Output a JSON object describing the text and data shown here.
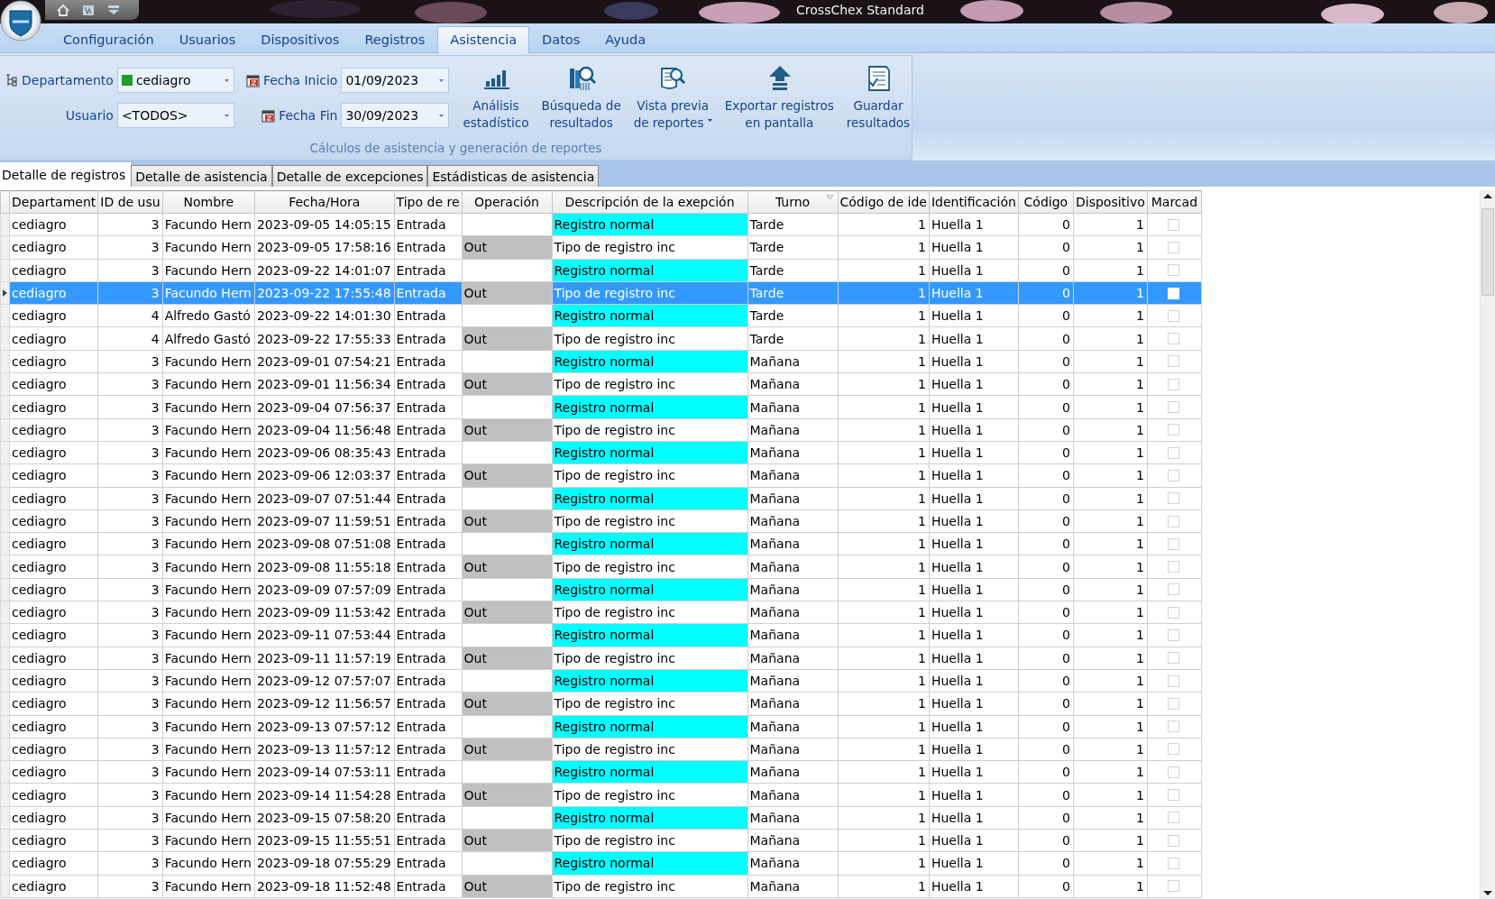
{
  "window": {
    "title": "CrossChex Standard"
  },
  "menu": [
    {
      "label": "Configuración",
      "selected": false
    },
    {
      "label": "Usuarios",
      "selected": false
    },
    {
      "label": "Dispositivos",
      "selected": false
    },
    {
      "label": "Registros",
      "selected": false
    },
    {
      "label": "Asistencia",
      "selected": true
    },
    {
      "label": "Datos",
      "selected": false
    },
    {
      "label": "Ayuda",
      "selected": false
    }
  ],
  "ribbon": {
    "department": {
      "label": "Departamento",
      "value": "cediagro"
    },
    "user": {
      "label": "Usuario",
      "value": "<TODOS>"
    },
    "start_date": {
      "label": "Fecha Inicio",
      "value": "01/09/2023"
    },
    "end_date": {
      "label": "Fecha Fin",
      "value": "30/09/2023"
    },
    "buttons": [
      {
        "lines": [
          "Análisis",
          "estadístico"
        ],
        "kind": "chart",
        "dropdown": false
      },
      {
        "lines": [
          "Búsqueda de",
          "resultados"
        ],
        "kind": "search",
        "dropdown": false
      },
      {
        "lines": [
          "Vista previa",
          "de reportes"
        ],
        "kind": "preview",
        "dropdown": true
      },
      {
        "lines": [
          "Exportar registros",
          "en pantalla"
        ],
        "kind": "export",
        "dropdown": false
      },
      {
        "lines": [
          "Guardar",
          "resultados"
        ],
        "kind": "save",
        "dropdown": false
      }
    ],
    "group_label": "Cálculos de asistencia y generación de reportes"
  },
  "sheet_tabs": [
    {
      "label": "Detalle de registros",
      "selected": true
    },
    {
      "label": "Detalle de asistencia",
      "selected": false
    },
    {
      "label": "Detalle de excepciones",
      "selected": false
    },
    {
      "label": "Estádisticas de asistencia",
      "selected": false
    }
  ],
  "table": {
    "columns": [
      "Departament",
      "ID de usu",
      "Nombre",
      "Fecha/Hora",
      "Tipo de re",
      "Operación",
      "Descripción de la exepción",
      "Turno",
      "Código de ide",
      "Identificación",
      "Código",
      "Dispositivo",
      "Marcad"
    ],
    "rows": [
      {
        "department": "cediagro",
        "user_id": "3",
        "name": "Facundo Hern",
        "datetime": "2023-09-05 14:05:15",
        "type": "Entrada",
        "kind": "in",
        "description": "Registro normal",
        "shift": "Tarde",
        "id_code": "1",
        "identification": "Huella 1",
        "code": "0",
        "device": "1",
        "marked": false,
        "selected": false
      },
      {
        "department": "cediagro",
        "user_id": "3",
        "name": "Facundo Hern",
        "datetime": "2023-09-05 17:58:16",
        "type": "Entrada",
        "kind": "out",
        "operation": "Out",
        "description": "Tipo de registro inc",
        "shift": "Tarde",
        "id_code": "1",
        "identification": "Huella 1",
        "code": "0",
        "device": "1",
        "marked": false,
        "selected": false
      },
      {
        "department": "cediagro",
        "user_id": "3",
        "name": "Facundo Hern",
        "datetime": "2023-09-22 14:01:07",
        "type": "Entrada",
        "kind": "in",
        "description": "Registro normal",
        "shift": "Tarde",
        "id_code": "1",
        "identification": "Huella 1",
        "code": "0",
        "device": "1",
        "marked": false,
        "selected": false
      },
      {
        "department": "cediagro",
        "user_id": "3",
        "name": "Facundo Hern",
        "datetime": "2023-09-22 17:55:48",
        "type": "Entrada",
        "kind": "out",
        "operation": "Out",
        "description": "Tipo de registro inc",
        "shift": "Tarde",
        "id_code": "1",
        "identification": "Huella 1",
        "code": "0",
        "device": "1",
        "marked": false,
        "selected": true
      },
      {
        "department": "cediagro",
        "user_id": "4",
        "name": "Alfredo Gastó",
        "datetime": "2023-09-22 14:01:30",
        "type": "Entrada",
        "kind": "in",
        "description": "Registro normal",
        "shift": "Tarde",
        "id_code": "1",
        "identification": "Huella 1",
        "code": "0",
        "device": "1",
        "marked": false,
        "selected": false
      },
      {
        "department": "cediagro",
        "user_id": "4",
        "name": "Alfredo Gastó",
        "datetime": "2023-09-22 17:55:33",
        "type": "Entrada",
        "kind": "out",
        "operation": "Out",
        "description": "Tipo de registro inc",
        "shift": "Tarde",
        "id_code": "1",
        "identification": "Huella 1",
        "code": "0",
        "device": "1",
        "marked": false,
        "selected": false
      },
      {
        "department": "cediagro",
        "user_id": "3",
        "name": "Facundo Hern",
        "datetime": "2023-09-01 07:54:21",
        "type": "Entrada",
        "kind": "in",
        "description": "Registro normal",
        "shift": "Mañana",
        "id_code": "1",
        "identification": "Huella 1",
        "code": "0",
        "device": "1",
        "marked": false,
        "selected": false
      },
      {
        "department": "cediagro",
        "user_id": "3",
        "name": "Facundo Hern",
        "datetime": "2023-09-01 11:56:34",
        "type": "Entrada",
        "kind": "out",
        "operation": "Out",
        "description": "Tipo de registro inc",
        "shift": "Mañana",
        "id_code": "1",
        "identification": "Huella 1",
        "code": "0",
        "device": "1",
        "marked": false,
        "selected": false
      },
      {
        "department": "cediagro",
        "user_id": "3",
        "name": "Facundo Hern",
        "datetime": "2023-09-04 07:56:37",
        "type": "Entrada",
        "kind": "in",
        "description": "Registro normal",
        "shift": "Mañana",
        "id_code": "1",
        "identification": "Huella 1",
        "code": "0",
        "device": "1",
        "marked": false,
        "selected": false
      },
      {
        "department": "cediagro",
        "user_id": "3",
        "name": "Facundo Hern",
        "datetime": "2023-09-04 11:56:48",
        "type": "Entrada",
        "kind": "out",
        "operation": "Out",
        "description": "Tipo de registro inc",
        "shift": "Mañana",
        "id_code": "1",
        "identification": "Huella 1",
        "code": "0",
        "device": "1",
        "marked": false,
        "selected": false
      },
      {
        "department": "cediagro",
        "user_id": "3",
        "name": "Facundo Hern",
        "datetime": "2023-09-06 08:35:43",
        "type": "Entrada",
        "kind": "in",
        "description": "Registro normal",
        "shift": "Mañana",
        "id_code": "1",
        "identification": "Huella 1",
        "code": "0",
        "device": "1",
        "marked": false,
        "selected": false
      },
      {
        "department": "cediagro",
        "user_id": "3",
        "name": "Facundo Hern",
        "datetime": "2023-09-06 12:03:37",
        "type": "Entrada",
        "kind": "out",
        "operation": "Out",
        "description": "Tipo de registro inc",
        "shift": "Mañana",
        "id_code": "1",
        "identification": "Huella 1",
        "code": "0",
        "device": "1",
        "marked": false,
        "selected": false
      },
      {
        "department": "cediagro",
        "user_id": "3",
        "name": "Facundo Hern",
        "datetime": "2023-09-07 07:51:44",
        "type": "Entrada",
        "kind": "in",
        "description": "Registro normal",
        "shift": "Mañana",
        "id_code": "1",
        "identification": "Huella 1",
        "code": "0",
        "device": "1",
        "marked": false,
        "selected": false
      },
      {
        "department": "cediagro",
        "user_id": "3",
        "name": "Facundo Hern",
        "datetime": "2023-09-07 11:59:51",
        "type": "Entrada",
        "kind": "out",
        "operation": "Out",
        "description": "Tipo de registro inc",
        "shift": "Mañana",
        "id_code": "1",
        "identification": "Huella 1",
        "code": "0",
        "device": "1",
        "marked": false,
        "selected": false
      },
      {
        "department": "cediagro",
        "user_id": "3",
        "name": "Facundo Hern",
        "datetime": "2023-09-08 07:51:08",
        "type": "Entrada",
        "kind": "in",
        "description": "Registro normal",
        "shift": "Mañana",
        "id_code": "1",
        "identification": "Huella 1",
        "code": "0",
        "device": "1",
        "marked": false,
        "selected": false
      },
      {
        "department": "cediagro",
        "user_id": "3",
        "name": "Facundo Hern",
        "datetime": "2023-09-08 11:55:18",
        "type": "Entrada",
        "kind": "out",
        "operation": "Out",
        "description": "Tipo de registro inc",
        "shift": "Mañana",
        "id_code": "1",
        "identification": "Huella 1",
        "code": "0",
        "device": "1",
        "marked": false,
        "selected": false
      },
      {
        "department": "cediagro",
        "user_id": "3",
        "name": "Facundo Hern",
        "datetime": "2023-09-09 07:57:09",
        "type": "Entrada",
        "kind": "in",
        "description": "Registro normal",
        "shift": "Mañana",
        "id_code": "1",
        "identification": "Huella 1",
        "code": "0",
        "device": "1",
        "marked": false,
        "selected": false
      },
      {
        "department": "cediagro",
        "user_id": "3",
        "name": "Facundo Hern",
        "datetime": "2023-09-09 11:53:42",
        "type": "Entrada",
        "kind": "out",
        "operation": "Out",
        "description": "Tipo de registro inc",
        "shift": "Mañana",
        "id_code": "1",
        "identification": "Huella 1",
        "code": "0",
        "device": "1",
        "marked": false,
        "selected": false
      },
      {
        "department": "cediagro",
        "user_id": "3",
        "name": "Facundo Hern",
        "datetime": "2023-09-11 07:53:44",
        "type": "Entrada",
        "kind": "in",
        "description": "Registro normal",
        "shift": "Mañana",
        "id_code": "1",
        "identification": "Huella 1",
        "code": "0",
        "device": "1",
        "marked": false,
        "selected": false
      },
      {
        "department": "cediagro",
        "user_id": "3",
        "name": "Facundo Hern",
        "datetime": "2023-09-11 11:57:19",
        "type": "Entrada",
        "kind": "out",
        "operation": "Out",
        "description": "Tipo de registro inc",
        "shift": "Mañana",
        "id_code": "1",
        "identification": "Huella 1",
        "code": "0",
        "device": "1",
        "marked": false,
        "selected": false
      },
      {
        "department": "cediagro",
        "user_id": "3",
        "name": "Facundo Hern",
        "datetime": "2023-09-12 07:57:07",
        "type": "Entrada",
        "kind": "in",
        "description": "Registro normal",
        "shift": "Mañana",
        "id_code": "1",
        "identification": "Huella 1",
        "code": "0",
        "device": "1",
        "marked": false,
        "selected": false
      },
      {
        "department": "cediagro",
        "user_id": "3",
        "name": "Facundo Hern",
        "datetime": "2023-09-12 11:56:57",
        "type": "Entrada",
        "kind": "out",
        "operation": "Out",
        "description": "Tipo de registro inc",
        "shift": "Mañana",
        "id_code": "1",
        "identification": "Huella 1",
        "code": "0",
        "device": "1",
        "marked": false,
        "selected": false
      },
      {
        "department": "cediagro",
        "user_id": "3",
        "name": "Facundo Hern",
        "datetime": "2023-09-13 07:57:12",
        "type": "Entrada",
        "kind": "in",
        "description": "Registro normal",
        "shift": "Mañana",
        "id_code": "1",
        "identification": "Huella 1",
        "code": "0",
        "device": "1",
        "marked": false,
        "selected": false
      },
      {
        "department": "cediagro",
        "user_id": "3",
        "name": "Facundo Hern",
        "datetime": "2023-09-13 11:57:12",
        "type": "Entrada",
        "kind": "out",
        "operation": "Out",
        "description": "Tipo de registro inc",
        "shift": "Mañana",
        "id_code": "1",
        "identification": "Huella 1",
        "code": "0",
        "device": "1",
        "marked": false,
        "selected": false
      },
      {
        "department": "cediagro",
        "user_id": "3",
        "name": "Facundo Hern",
        "datetime": "2023-09-14 07:53:11",
        "type": "Entrada",
        "kind": "in",
        "description": "Registro normal",
        "shift": "Mañana",
        "id_code": "1",
        "identification": "Huella 1",
        "code": "0",
        "device": "1",
        "marked": false,
        "selected": false
      },
      {
        "department": "cediagro",
        "user_id": "3",
        "name": "Facundo Hern",
        "datetime": "2023-09-14 11:54:28",
        "type": "Entrada",
        "kind": "out",
        "operation": "Out",
        "description": "Tipo de registro inc",
        "shift": "Mañana",
        "id_code": "1",
        "identification": "Huella 1",
        "code": "0",
        "device": "1",
        "marked": false,
        "selected": false
      },
      {
        "department": "cediagro",
        "user_id": "3",
        "name": "Facundo Hern",
        "datetime": "2023-09-15 07:58:20",
        "type": "Entrada",
        "kind": "in",
        "description": "Registro normal",
        "shift": "Mañana",
        "id_code": "1",
        "identification": "Huella 1",
        "code": "0",
        "device": "1",
        "marked": false,
        "selected": false
      },
      {
        "department": "cediagro",
        "user_id": "3",
        "name": "Facundo Hern",
        "datetime": "2023-09-15 11:55:51",
        "type": "Entrada",
        "kind": "out",
        "operation": "Out",
        "description": "Tipo de registro inc",
        "shift": "Mañana",
        "id_code": "1",
        "identification": "Huella 1",
        "code": "0",
        "device": "1",
        "marked": false,
        "selected": false
      },
      {
        "department": "cediagro",
        "user_id": "3",
        "name": "Facundo Hern",
        "datetime": "2023-09-18 07:55:29",
        "type": "Entrada",
        "kind": "in",
        "description": "Registro normal",
        "shift": "Mañana",
        "id_code": "1",
        "identification": "Huella 1",
        "code": "0",
        "device": "1",
        "marked": false,
        "selected": false
      },
      {
        "department": "cediagro",
        "user_id": "3",
        "name": "Facundo Hern",
        "datetime": "2023-09-18 11:52:48",
        "type": "Entrada",
        "kind": "out",
        "operation": "Out",
        "description": "Tipo de registro inc",
        "shift": "Mañana",
        "id_code": "1",
        "identification": "Huella 1",
        "code": "0",
        "device": "1",
        "marked": false,
        "selected": false
      }
    ]
  }
}
